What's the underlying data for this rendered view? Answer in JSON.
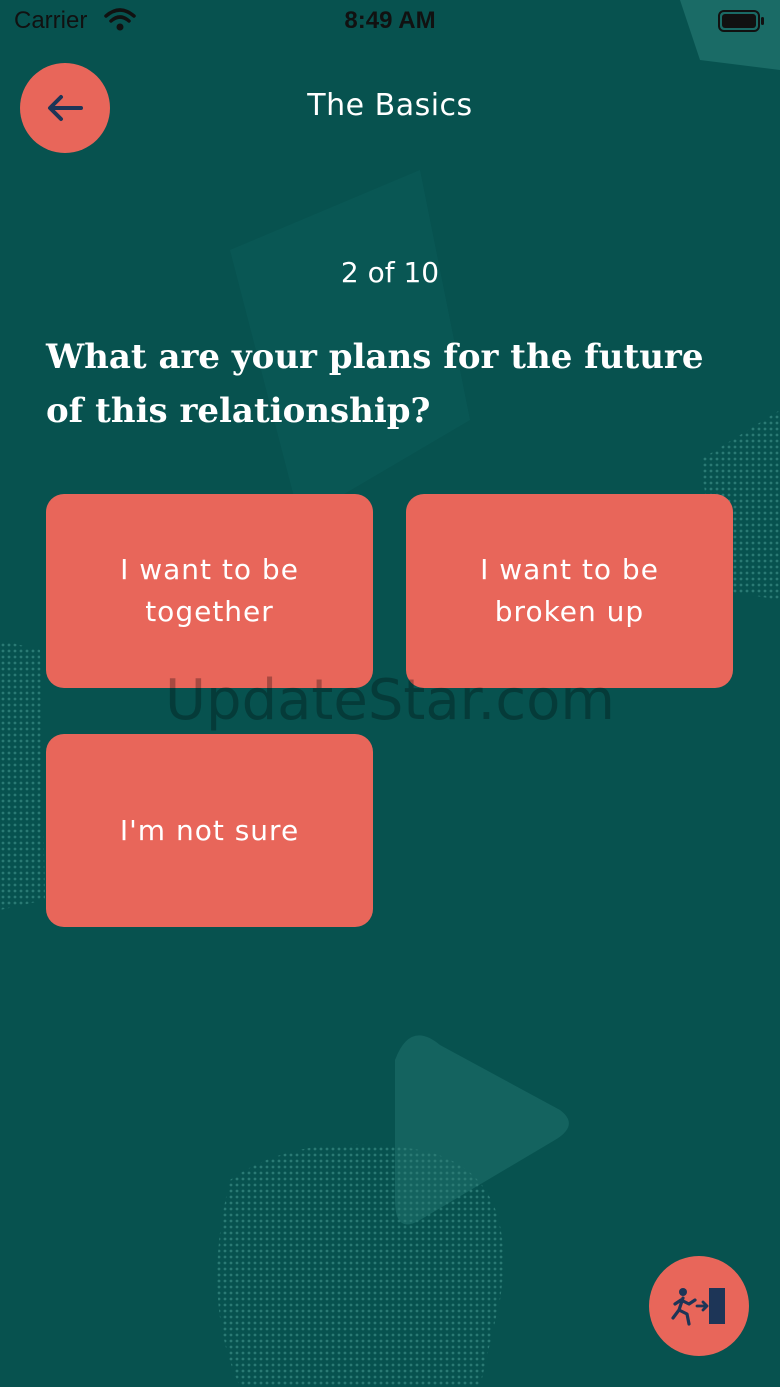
{
  "status_bar": {
    "carrier": "Carrier",
    "time": "8:49 AM"
  },
  "header": {
    "title": "The Basics",
    "back_icon": "arrow-left-icon"
  },
  "progress": {
    "text": "2 of 10"
  },
  "question": {
    "text": "What are your plans for the future of this relationship?"
  },
  "answers": [
    {
      "label": "I want to be together"
    },
    {
      "label": "I want to be broken up"
    },
    {
      "label": "I'm not sure"
    }
  ],
  "watermark": "UpdateStar.com",
  "exit_button": {
    "icon": "exit-running-icon"
  },
  "colors": {
    "background": "#07524f",
    "accent": "#e8665a",
    "icon_dark": "#1d3557"
  }
}
